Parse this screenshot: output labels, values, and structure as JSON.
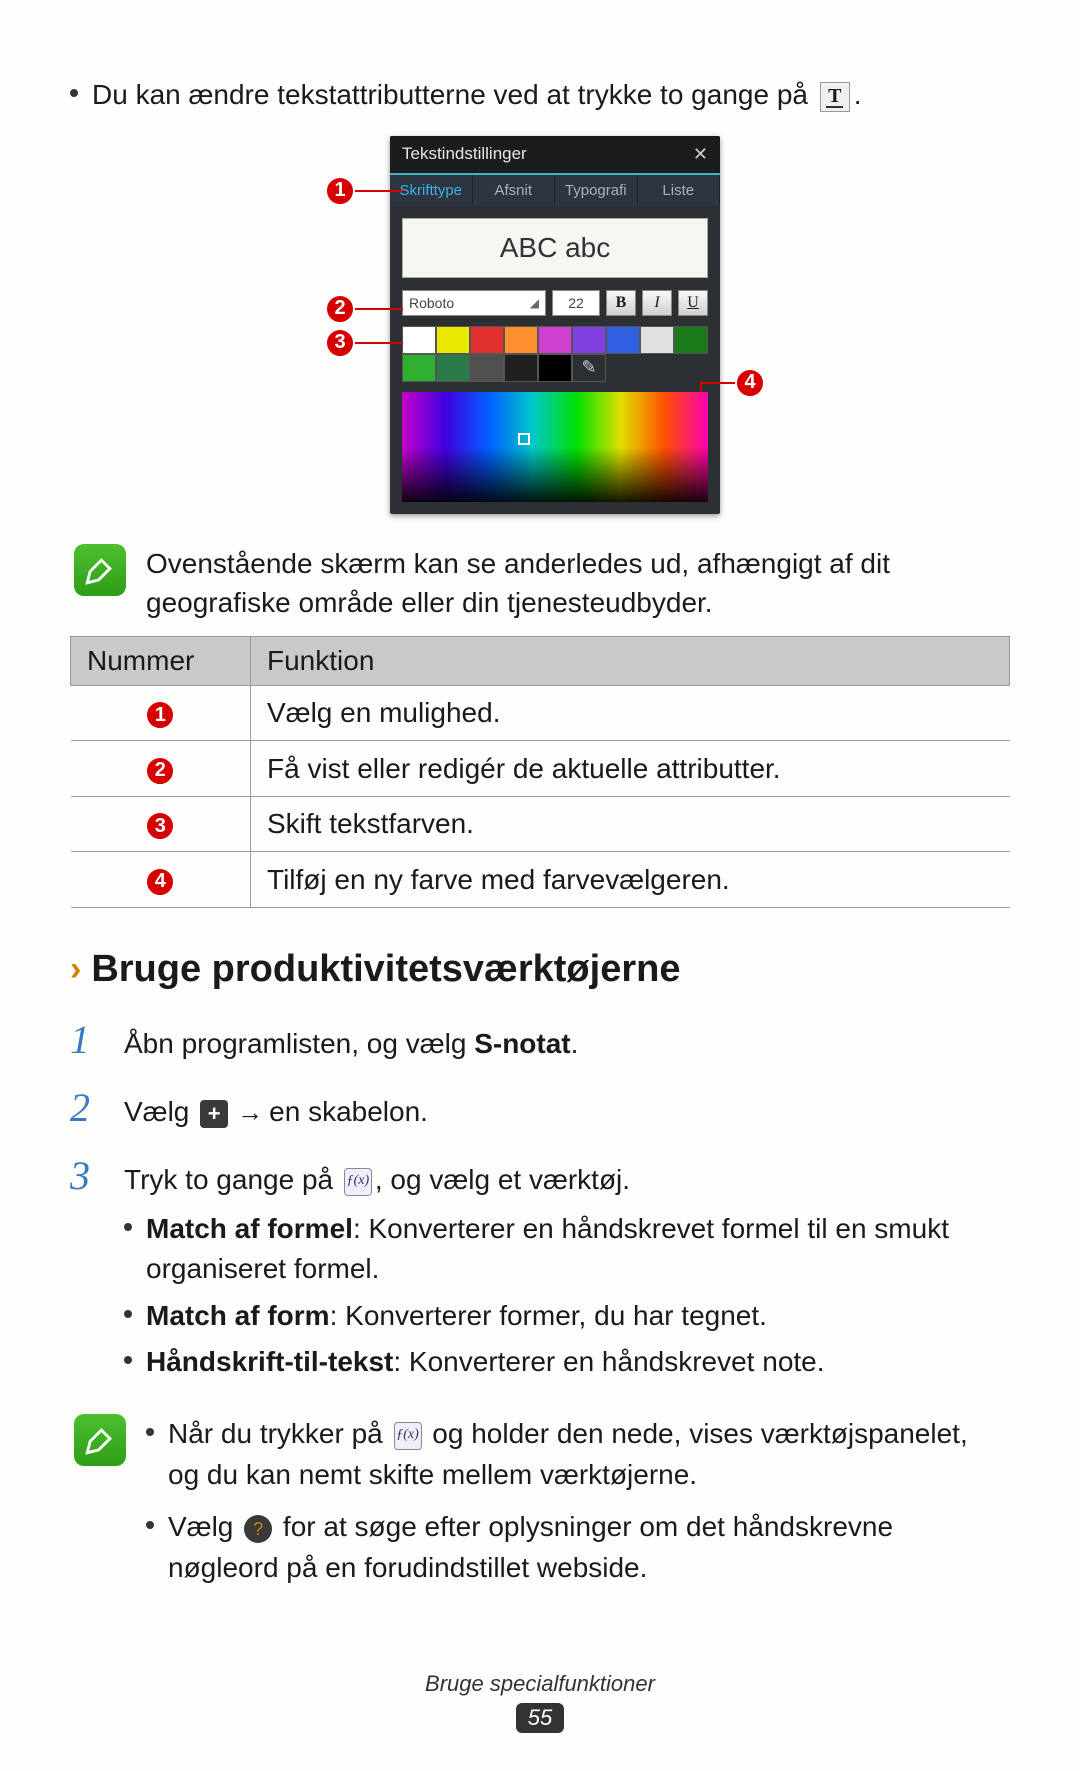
{
  "intro": {
    "text_before": "Du kan ændre tekstattributterne ved at trykke to gange på ",
    "text_after": "."
  },
  "dialog": {
    "title": "Tekstindstillinger",
    "tabs": [
      "Skrifttype",
      "Afsnit",
      "Typografi",
      "Liste"
    ],
    "preview": "ABC abc",
    "font": "Roboto",
    "size": "22",
    "styles": {
      "bold": "B",
      "italic": "I",
      "underline": "U"
    },
    "swatches_row1": [
      "#ffffff",
      "#e8e800",
      "#e03030",
      "#ff9030",
      "#d040d0",
      "#8040e0",
      "#3060e0",
      "#e0e0e0"
    ],
    "swatches_row2": [
      "#1a7a1a",
      "#30b030",
      "#2a7a4a",
      "#505050",
      "#202020",
      "#000000"
    ],
    "eyedropper_label": "eyedropper"
  },
  "note1": "Ovenstående skærm kan se anderledes ud, afhængigt af dit geografiske område eller din tjenesteudbyder.",
  "table": {
    "headers": [
      "Nummer",
      "Funktion"
    ],
    "rows": [
      {
        "num": "1",
        "text": "Vælg en mulighed."
      },
      {
        "num": "2",
        "text": "Få vist eller redigér de aktuelle attributter."
      },
      {
        "num": "3",
        "text": "Skift tekstfarven."
      },
      {
        "num": "4",
        "text": "Tilføj en ny farve med farvevælgeren."
      }
    ]
  },
  "section_title": "Bruge produktivitetsværktøjerne",
  "steps": {
    "s1": {
      "before": "Åbn programlisten, og vælg ",
      "bold": "S-notat",
      "after": "."
    },
    "s2": {
      "before": "Vælg ",
      "after_arrow": "en skabelon."
    },
    "s3": {
      "before": "Tryk to gange på ",
      "after": ", og vælg et værktøj."
    }
  },
  "tools": [
    {
      "bold": "Match af formel",
      "rest": ": Konverterer en håndskrevet formel til en smukt organiseret formel."
    },
    {
      "bold": "Match af form",
      "rest": ": Konverterer former, du har tegnet."
    },
    {
      "bold": "Håndskrift-til-tekst",
      "rest": ": Konverterer en håndskrevet note."
    }
  ],
  "note2": {
    "item1_before": "Når du trykker på ",
    "item1_after": " og holder den nede, vises værktøjspanelet, og du kan nemt skifte mellem værktøjerne.",
    "item2_before": "Vælg ",
    "item2_after": " for at søge efter oplysninger om det håndskrevne nøgleord på en forudindstillet webside."
  },
  "footer": {
    "title": "Bruge specialfunktioner",
    "page": "55"
  }
}
